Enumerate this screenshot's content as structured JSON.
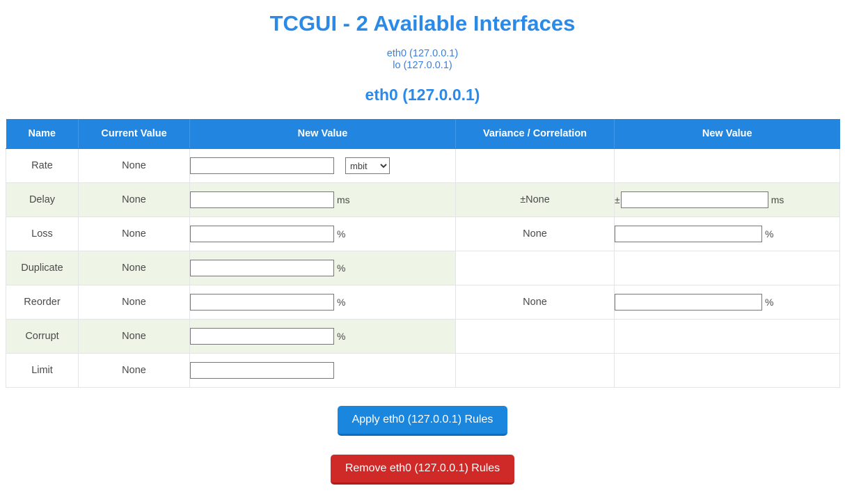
{
  "header": {
    "title": "TCGUI - 2 Available Interfaces",
    "interfaces": [
      {
        "label": "eth0 (127.0.0.1)"
      },
      {
        "label": "lo (127.0.0.1)"
      }
    ],
    "selected_interface": "eth0 (127.0.0.1)"
  },
  "table": {
    "columns": [
      {
        "label": "Name"
      },
      {
        "label": "Current Value"
      },
      {
        "label": "New Value"
      },
      {
        "label": "Variance / Correlation"
      },
      {
        "label": "New Value"
      }
    ],
    "rows": [
      {
        "name": "Rate",
        "current": "None",
        "new_value": "",
        "unit": "",
        "select": "mbit",
        "select_options": [
          "mbit"
        ],
        "variance": "",
        "variance_new": "",
        "variance_prefix": "",
        "variance_unit": "",
        "has_variance": false
      },
      {
        "name": "Delay",
        "current": "None",
        "new_value": "",
        "unit": "ms",
        "variance": "±None",
        "variance_new": "",
        "variance_prefix": "±",
        "variance_unit": "ms",
        "has_variance": true
      },
      {
        "name": "Loss",
        "current": "None",
        "new_value": "",
        "unit": "%",
        "variance": "None",
        "variance_new": "",
        "variance_prefix": "",
        "variance_unit": "%",
        "has_variance": true
      },
      {
        "name": "Duplicate",
        "current": "None",
        "new_value": "",
        "unit": "%",
        "variance": "",
        "variance_new": "",
        "variance_prefix": "",
        "variance_unit": "",
        "has_variance": false
      },
      {
        "name": "Reorder",
        "current": "None",
        "new_value": "",
        "unit": "%",
        "variance": "None",
        "variance_new": "",
        "variance_prefix": "",
        "variance_unit": "%",
        "has_variance": true
      },
      {
        "name": "Corrupt",
        "current": "None",
        "new_value": "",
        "unit": "%",
        "variance": "",
        "variance_new": "",
        "variance_prefix": "",
        "variance_unit": "",
        "has_variance": false
      },
      {
        "name": "Limit",
        "current": "None",
        "new_value": "",
        "unit": "",
        "variance": "",
        "variance_new": "",
        "variance_prefix": "",
        "variance_unit": "",
        "has_variance": false
      }
    ]
  },
  "actions": {
    "apply_label": "Apply eth0 (127.0.0.1) Rules",
    "remove_label": "Remove eth0 (127.0.0.1) Rules"
  },
  "colors": {
    "accent": "#2285e0",
    "title": "#2b8ae8",
    "link": "#3a7fe0",
    "apply": "#1b86dd",
    "remove": "#cf2a28",
    "stripe": "#eef5e7"
  }
}
